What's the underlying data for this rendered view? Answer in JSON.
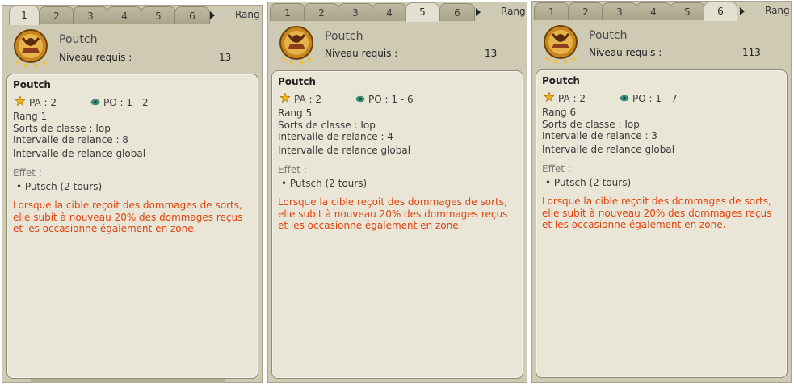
{
  "panels": [
    {
      "tabs": [
        "1",
        "2",
        "3",
        "4",
        "5",
        "6"
      ],
      "active_tab": 0,
      "rang_label": "Rang",
      "spell_name": "Poutch",
      "niveau_label": "Niveau requis :",
      "niveau_value": "13",
      "card": {
        "title": "Poutch",
        "pa": "PA : 2",
        "po": "PO : 1 - 2",
        "rang": "Rang 1",
        "sorts": "Sorts de classe : Iop",
        "relance": "Intervalle de relance : 8",
        "relance_global": "Intervalle de relance global",
        "effet_label": "Effet :",
        "effet_item": "• Putsch (2 tours)",
        "desc": "Lorsque la cible reçoit des dommages de sorts, elle subit à nouveau 20% des dommages reçus et les occasionne également en zone."
      }
    },
    {
      "tabs": [
        "1",
        "2",
        "3",
        "4",
        "5",
        "6"
      ],
      "active_tab": 4,
      "rang_label": "Rang",
      "spell_name": "Poutch",
      "niveau_label": "Niveau requis :",
      "niveau_value": "13",
      "card": {
        "title": "Poutch",
        "pa": "PA : 2",
        "po": "PO : 1 - 6",
        "rang": "Rang 5",
        "sorts": "Sorts de classe : Iop",
        "relance": "Intervalle de relance : 4",
        "relance_global": "Intervalle de relance global",
        "effet_label": "Effet :",
        "effet_item": "• Putsch (2 tours)",
        "desc": "Lorsque la cible reçoit des dommages de sorts, elle subit à nouveau 20% des dommages reçus et les occasionne également en zone."
      }
    },
    {
      "tabs": [
        "1",
        "2",
        "3",
        "4",
        "5",
        "6"
      ],
      "active_tab": 5,
      "rang_label": "Rang",
      "spell_name": "Poutch",
      "niveau_label": "Niveau requis :",
      "niveau_value": "113",
      "card": {
        "title": "Poutch",
        "pa": "PA : 2",
        "po": "PO : 1 - 7",
        "rang": "Rang 6",
        "sorts": "Sorts de classe : Iop",
        "relance": "Intervalle de relance : 3",
        "relance_global": "Intervalle de relance global",
        "effet_label": "Effet :",
        "effet_item": "• Putsch (2 tours)",
        "desc": "Lorsque la cible reçoit des dommages de sorts, elle subit à nouveau 20% des dommages reçus et les occasionne également en zone."
      }
    }
  ],
  "icons": {
    "spell": "poutch-spell-icon",
    "pa": "star-icon",
    "po": "eye-icon",
    "tab_next": "arrow-right-icon"
  },
  "colors": {
    "panel_bg": "#cfcab4",
    "card_bg": "#e9e6d8",
    "description": "#e0440e"
  }
}
